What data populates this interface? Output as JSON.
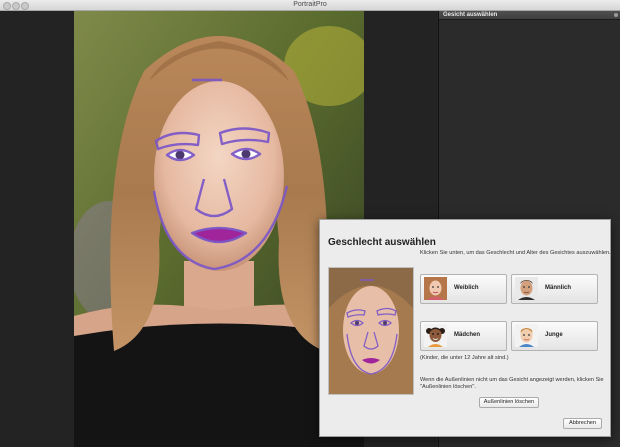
{
  "window": {
    "title": "PortraitPro"
  },
  "side_panel": {
    "header": "Gesicht auswählen"
  },
  "dialog": {
    "title": "Geschlecht auswählen",
    "hint": "Klicken Sie unten, um das Geschlecht und Alter des Gesichtes auszuwählen.",
    "options": {
      "female": "Weiblich",
      "male": "Männlich",
      "girl": "Mädchen",
      "boy": "Junge"
    },
    "kids_note": "(Kinder, die unter 12 Jahre alt sind.)",
    "outline_note_line1": "Wenn die Außenlinien nicht um das Gesicht angezeigt werden, klicken Sie",
    "outline_note_line2": "\"Außenlinien löschen\".",
    "clear_outlines_button": "Außenlinien löschen",
    "cancel_button": "Abbrechen"
  },
  "colors": {
    "face_outline": "#7b57c8",
    "lips": "#a0249a",
    "app_background": "#262626",
    "dialog_background": "#ececec"
  }
}
